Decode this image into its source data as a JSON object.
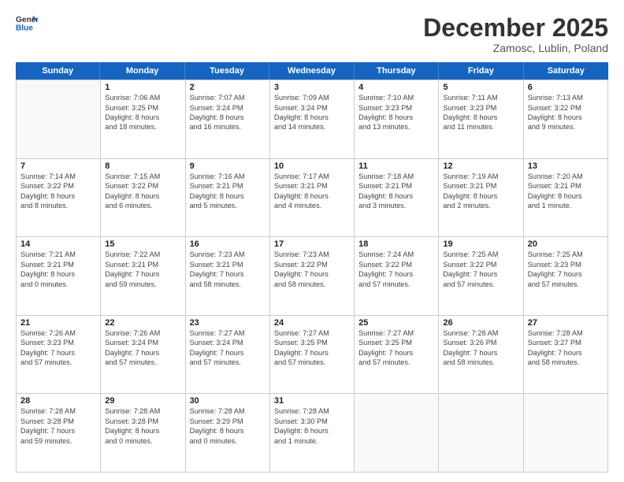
{
  "logo": {
    "line1": "General",
    "line2": "Blue"
  },
  "title": "December 2025",
  "subtitle": "Zamosc, Lublin, Poland",
  "days_of_week": [
    "Sunday",
    "Monday",
    "Tuesday",
    "Wednesday",
    "Thursday",
    "Friday",
    "Saturday"
  ],
  "weeks": [
    [
      {
        "day": "",
        "lines": []
      },
      {
        "day": "1",
        "lines": [
          "Sunrise: 7:06 AM",
          "Sunset: 3:25 PM",
          "Daylight: 8 hours",
          "and 18 minutes."
        ]
      },
      {
        "day": "2",
        "lines": [
          "Sunrise: 7:07 AM",
          "Sunset: 3:24 PM",
          "Daylight: 8 hours",
          "and 16 minutes."
        ]
      },
      {
        "day": "3",
        "lines": [
          "Sunrise: 7:09 AM",
          "Sunset: 3:24 PM",
          "Daylight: 8 hours",
          "and 14 minutes."
        ]
      },
      {
        "day": "4",
        "lines": [
          "Sunrise: 7:10 AM",
          "Sunset: 3:23 PM",
          "Daylight: 8 hours",
          "and 13 minutes."
        ]
      },
      {
        "day": "5",
        "lines": [
          "Sunrise: 7:11 AM",
          "Sunset: 3:23 PM",
          "Daylight: 8 hours",
          "and 11 minutes."
        ]
      },
      {
        "day": "6",
        "lines": [
          "Sunrise: 7:13 AM",
          "Sunset: 3:22 PM",
          "Daylight: 8 hours",
          "and 9 minutes."
        ]
      }
    ],
    [
      {
        "day": "7",
        "lines": [
          "Sunrise: 7:14 AM",
          "Sunset: 3:22 PM",
          "Daylight: 8 hours",
          "and 8 minutes."
        ]
      },
      {
        "day": "8",
        "lines": [
          "Sunrise: 7:15 AM",
          "Sunset: 3:22 PM",
          "Daylight: 8 hours",
          "and 6 minutes."
        ]
      },
      {
        "day": "9",
        "lines": [
          "Sunrise: 7:16 AM",
          "Sunset: 3:21 PM",
          "Daylight: 8 hours",
          "and 5 minutes."
        ]
      },
      {
        "day": "10",
        "lines": [
          "Sunrise: 7:17 AM",
          "Sunset: 3:21 PM",
          "Daylight: 8 hours",
          "and 4 minutes."
        ]
      },
      {
        "day": "11",
        "lines": [
          "Sunrise: 7:18 AM",
          "Sunset: 3:21 PM",
          "Daylight: 8 hours",
          "and 3 minutes."
        ]
      },
      {
        "day": "12",
        "lines": [
          "Sunrise: 7:19 AM",
          "Sunset: 3:21 PM",
          "Daylight: 8 hours",
          "and 2 minutes."
        ]
      },
      {
        "day": "13",
        "lines": [
          "Sunrise: 7:20 AM",
          "Sunset: 3:21 PM",
          "Daylight: 8 hours",
          "and 1 minute."
        ]
      }
    ],
    [
      {
        "day": "14",
        "lines": [
          "Sunrise: 7:21 AM",
          "Sunset: 3:21 PM",
          "Daylight: 8 hours",
          "and 0 minutes."
        ]
      },
      {
        "day": "15",
        "lines": [
          "Sunrise: 7:22 AM",
          "Sunset: 3:21 PM",
          "Daylight: 7 hours",
          "and 59 minutes."
        ]
      },
      {
        "day": "16",
        "lines": [
          "Sunrise: 7:23 AM",
          "Sunset: 3:21 PM",
          "Daylight: 7 hours",
          "and 58 minutes."
        ]
      },
      {
        "day": "17",
        "lines": [
          "Sunrise: 7:23 AM",
          "Sunset: 3:22 PM",
          "Daylight: 7 hours",
          "and 58 minutes."
        ]
      },
      {
        "day": "18",
        "lines": [
          "Sunrise: 7:24 AM",
          "Sunset: 3:22 PM",
          "Daylight: 7 hours",
          "and 57 minutes."
        ]
      },
      {
        "day": "19",
        "lines": [
          "Sunrise: 7:25 AM",
          "Sunset: 3:22 PM",
          "Daylight: 7 hours",
          "and 57 minutes."
        ]
      },
      {
        "day": "20",
        "lines": [
          "Sunrise: 7:25 AM",
          "Sunset: 3:23 PM",
          "Daylight: 7 hours",
          "and 57 minutes."
        ]
      }
    ],
    [
      {
        "day": "21",
        "lines": [
          "Sunrise: 7:26 AM",
          "Sunset: 3:23 PM",
          "Daylight: 7 hours",
          "and 57 minutes."
        ]
      },
      {
        "day": "22",
        "lines": [
          "Sunrise: 7:26 AM",
          "Sunset: 3:24 PM",
          "Daylight: 7 hours",
          "and 57 minutes."
        ]
      },
      {
        "day": "23",
        "lines": [
          "Sunrise: 7:27 AM",
          "Sunset: 3:24 PM",
          "Daylight: 7 hours",
          "and 57 minutes."
        ]
      },
      {
        "day": "24",
        "lines": [
          "Sunrise: 7:27 AM",
          "Sunset: 3:25 PM",
          "Daylight: 7 hours",
          "and 57 minutes."
        ]
      },
      {
        "day": "25",
        "lines": [
          "Sunrise: 7:27 AM",
          "Sunset: 3:25 PM",
          "Daylight: 7 hours",
          "and 57 minutes."
        ]
      },
      {
        "day": "26",
        "lines": [
          "Sunrise: 7:28 AM",
          "Sunset: 3:26 PM",
          "Daylight: 7 hours",
          "and 58 minutes."
        ]
      },
      {
        "day": "27",
        "lines": [
          "Sunrise: 7:28 AM",
          "Sunset: 3:27 PM",
          "Daylight: 7 hours",
          "and 58 minutes."
        ]
      }
    ],
    [
      {
        "day": "28",
        "lines": [
          "Sunrise: 7:28 AM",
          "Sunset: 3:28 PM",
          "Daylight: 7 hours",
          "and 59 minutes."
        ]
      },
      {
        "day": "29",
        "lines": [
          "Sunrise: 7:28 AM",
          "Sunset: 3:28 PM",
          "Daylight: 8 hours",
          "and 0 minutes."
        ]
      },
      {
        "day": "30",
        "lines": [
          "Sunrise: 7:28 AM",
          "Sunset: 3:29 PM",
          "Daylight: 8 hours",
          "and 0 minutes."
        ]
      },
      {
        "day": "31",
        "lines": [
          "Sunrise: 7:28 AM",
          "Sunset: 3:30 PM",
          "Daylight: 8 hours",
          "and 1 minute."
        ]
      },
      {
        "day": "",
        "lines": []
      },
      {
        "day": "",
        "lines": []
      },
      {
        "day": "",
        "lines": []
      }
    ]
  ]
}
